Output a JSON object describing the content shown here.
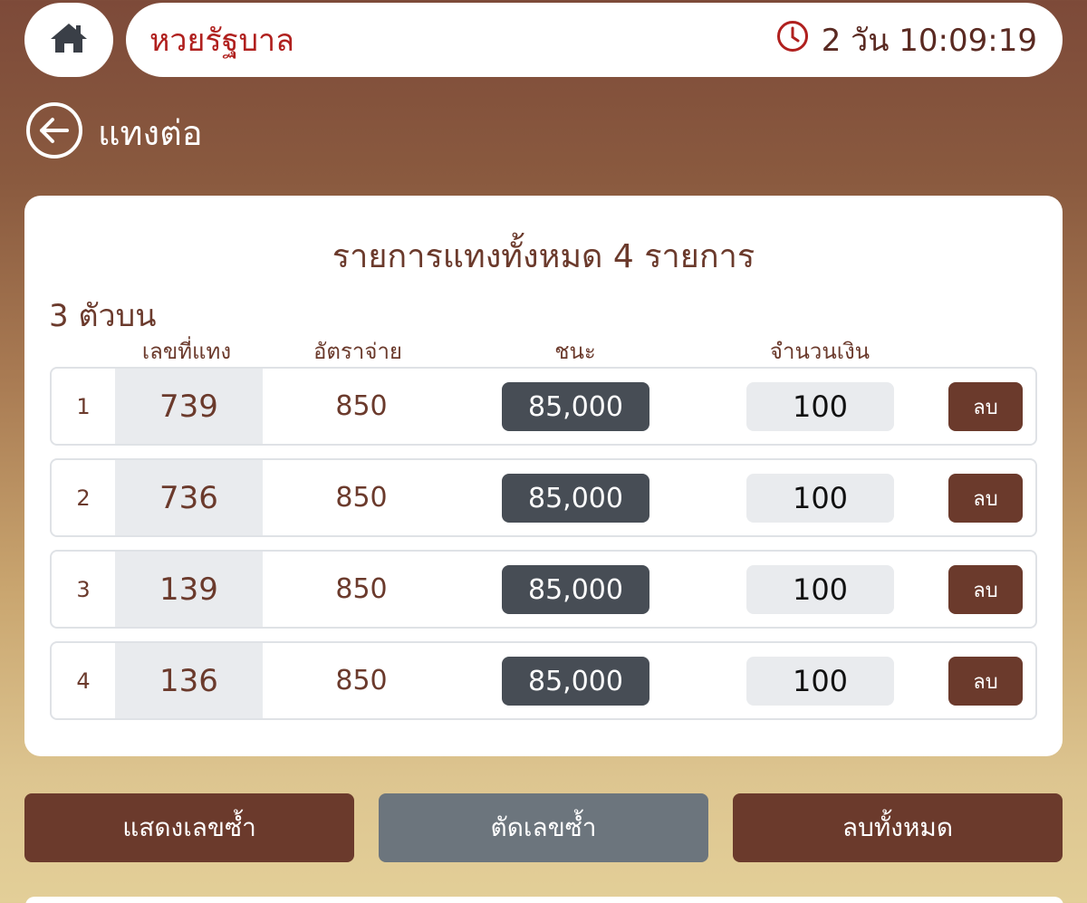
{
  "header": {
    "lottery_name": "หวยรัฐบาล",
    "countdown": "2 วัน 10:09:19"
  },
  "back": {
    "label": "แทงต่อ"
  },
  "card": {
    "title": "รายการแทงทั้งหมด 4 รายการ",
    "section_label": "3 ตัวบน",
    "columns": {
      "number": "เลขที่แทง",
      "rate": "อัตราจ่าย",
      "win": "ชนะ",
      "amount": "จำนวนเงิน"
    },
    "rows": [
      {
        "index": "1",
        "number": "739",
        "rate": "850",
        "win": "85,000",
        "amount": "100",
        "delete_label": "ลบ"
      },
      {
        "index": "2",
        "number": "736",
        "rate": "850",
        "win": "85,000",
        "amount": "100",
        "delete_label": "ลบ"
      },
      {
        "index": "3",
        "number": "139",
        "rate": "850",
        "win": "85,000",
        "amount": "100",
        "delete_label": "ลบ"
      },
      {
        "index": "4",
        "number": "136",
        "rate": "850",
        "win": "85,000",
        "amount": "100",
        "delete_label": "ลบ"
      }
    ]
  },
  "actions": {
    "show_duplicates": "แสดงเลขซ้ำ",
    "remove_duplicates": "ตัดเลขซ้ำ",
    "delete_all": "ลบทั้งหมด"
  },
  "icons": {
    "home": "home-icon",
    "clock": "clock-icon",
    "back": "arrow-left-circle-icon"
  },
  "colors": {
    "brand_brown": "#6b3a2c",
    "lottery_red": "#b0201e",
    "win_badge": "#474d55",
    "neutral_button": "#6c757d"
  }
}
